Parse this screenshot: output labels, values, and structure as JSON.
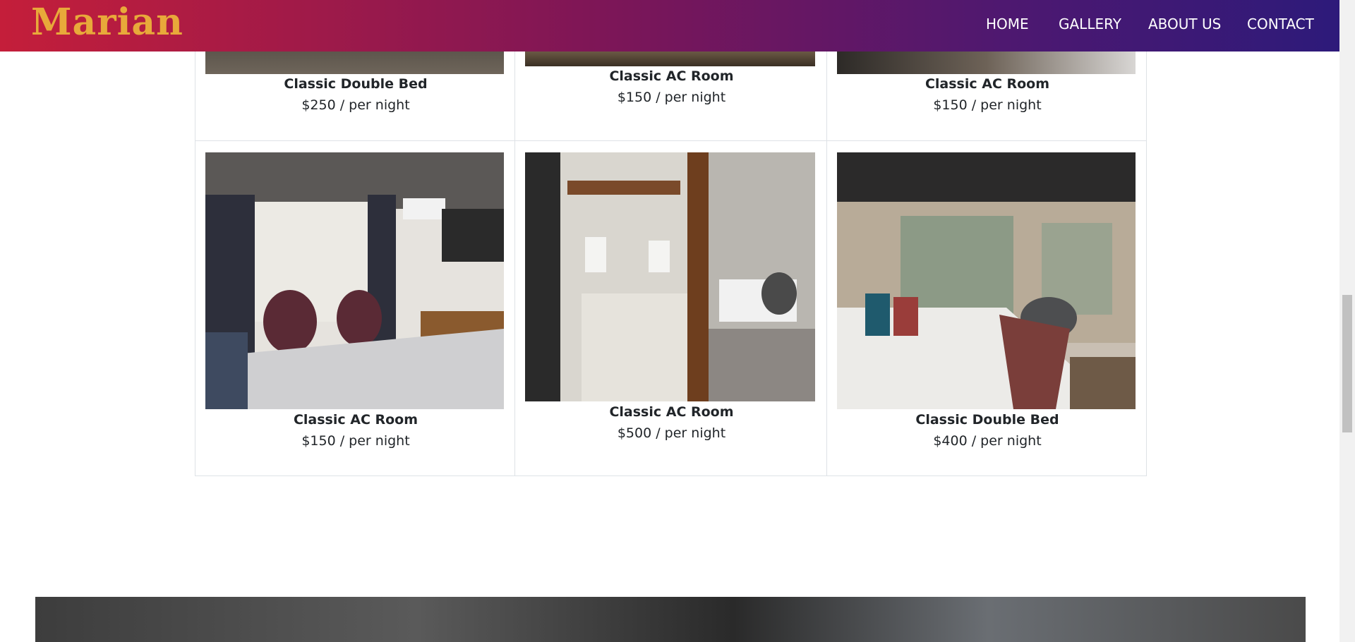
{
  "brand": {
    "name": "Marian"
  },
  "nav": {
    "home": "HOME",
    "gallery": "GALLERY",
    "about": "ABOUT US",
    "contact": "CONTACT"
  },
  "rooms": [
    {
      "title": "Classic Double Bed",
      "price": "$250 / per night"
    },
    {
      "title": "Classic AC Room",
      "price": "$150 / per night"
    },
    {
      "title": "Classic AC Room",
      "price": "$150 / per night"
    },
    {
      "title": "Classic AC Room",
      "price": "$150 / per night"
    },
    {
      "title": "Classic AC Room",
      "price": "$500 / per night"
    },
    {
      "title": "Classic Double Bed",
      "price": "$400 / per night"
    }
  ],
  "colors": {
    "brand_text": "#e8a93a",
    "nav_gradient_start": "#c41e3a",
    "nav_gradient_end": "#2d1a7a"
  }
}
